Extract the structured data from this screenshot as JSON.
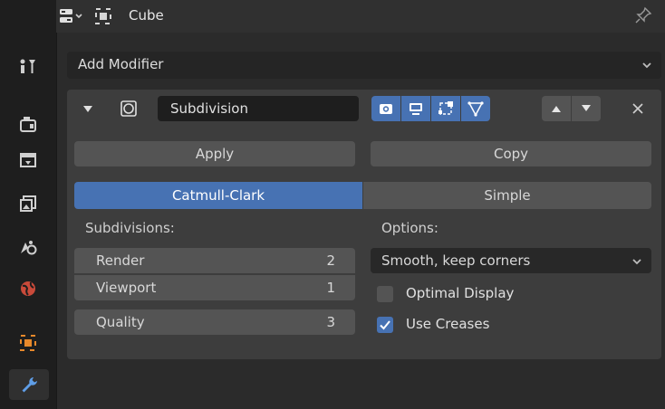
{
  "header": {
    "object_name": "Cube"
  },
  "add_modifier": {
    "label": "Add Modifier"
  },
  "modifier": {
    "name": "Subdivision",
    "apply_label": "Apply",
    "copy_label": "Copy",
    "algorithm": {
      "options": [
        "Catmull-Clark",
        "Simple"
      ],
      "selected": "Catmull-Clark"
    },
    "subdivisions": {
      "label": "Subdivisions:",
      "render_label": "Render",
      "render_value": "2",
      "viewport_label": "Viewport",
      "viewport_value": "1",
      "quality_label": "Quality",
      "quality_value": "3"
    },
    "options": {
      "label": "Options:",
      "uv_smooth": "Smooth, keep corners",
      "optimal_display_label": "Optimal Display",
      "optimal_display_checked": false,
      "use_creases_label": "Use Creases",
      "use_creases_checked": true
    }
  },
  "colors": {
    "accent": "#4772b3",
    "panel": "#3d3d3d",
    "background": "#2b2b2b"
  },
  "icons": {
    "tabs": [
      "tool-icon",
      "render-icon",
      "output-icon",
      "view-layer-icon",
      "scene-icon",
      "world-icon",
      "object-icon",
      "modifier-wrench-icon"
    ]
  }
}
